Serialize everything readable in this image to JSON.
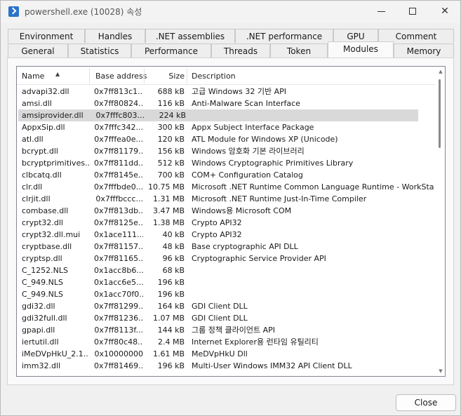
{
  "window": {
    "title": "powershell.exe (10028) 속성",
    "minimize_glyph": "—",
    "maximize_glyph": "☐",
    "close_glyph": "✕"
  },
  "tabs_top_row": [
    {
      "label": "Environment"
    },
    {
      "label": "Handles"
    },
    {
      "label": ".NET assemblies"
    },
    {
      "label": ".NET performance"
    },
    {
      "label": "GPU"
    },
    {
      "label": "Comment"
    }
  ],
  "tabs_bottom_row": [
    {
      "label": "General"
    },
    {
      "label": "Statistics"
    },
    {
      "label": "Performance"
    },
    {
      "label": "Threads"
    },
    {
      "label": "Token"
    },
    {
      "label": "Modules",
      "active": true
    },
    {
      "label": "Memory"
    }
  ],
  "table": {
    "columns": [
      "Name",
      "Base address",
      "Size",
      "Description"
    ],
    "sorted_column": "Name",
    "selected_index": 2,
    "rows": [
      {
        "name": "advapi32.dll",
        "addr": "0x7ff813c1...",
        "size": "688 kB",
        "desc": "고급 Windows 32 기반 API"
      },
      {
        "name": "amsi.dll",
        "addr": "0x7ff80824...",
        "size": "116 kB",
        "desc": "Anti-Malware Scan Interface"
      },
      {
        "name": "amsiprovider.dll",
        "addr": "0x7fffc803...",
        "size": "224 kB",
        "desc": ""
      },
      {
        "name": "AppxSip.dll",
        "addr": "0x7fffc342...",
        "size": "300 kB",
        "desc": "Appx Subject Interface Package"
      },
      {
        "name": "atl.dll",
        "addr": "0x7fffea0e...",
        "size": "120 kB",
        "desc": "ATL Module for Windows XP (Unicode)"
      },
      {
        "name": "bcrypt.dll",
        "addr": "0x7ff81179...",
        "size": "156 kB",
        "desc": "Windows 암호화 기본 라이브러리"
      },
      {
        "name": "bcryptprimitives...",
        "addr": "0x7ff811dd...",
        "size": "512 kB",
        "desc": "Windows Cryptographic Primitives Library"
      },
      {
        "name": "clbcatq.dll",
        "addr": "0x7ff8145e...",
        "size": "700 kB",
        "desc": "COM+ Configuration Catalog"
      },
      {
        "name": "clr.dll",
        "addr": "0x7fffbde0...",
        "size": "10.75 MB",
        "desc": "Microsoft .NET Runtime Common Language Runtime - WorkStation"
      },
      {
        "name": "clrjit.dll",
        "addr": "0x7fffbccc...",
        "size": "1.31 MB",
        "desc": "Microsoft .NET Runtime Just-In-Time Compiler"
      },
      {
        "name": "combase.dll",
        "addr": "0x7ff813db...",
        "size": "3.47 MB",
        "desc": "Windows용 Microsoft COM"
      },
      {
        "name": "crypt32.dll",
        "addr": "0x7ff8125e...",
        "size": "1.38 MB",
        "desc": "Crypto API32"
      },
      {
        "name": "crypt32.dll.mui",
        "addr": "0x1ace111...",
        "size": "40 kB",
        "desc": "Crypto API32"
      },
      {
        "name": "cryptbase.dll",
        "addr": "0x7ff81157...",
        "size": "48 kB",
        "desc": "Base cryptographic API DLL"
      },
      {
        "name": "cryptsp.dll",
        "addr": "0x7ff81165...",
        "size": "96 kB",
        "desc": "Cryptographic Service Provider API"
      },
      {
        "name": "C_1252.NLS",
        "addr": "0x1acc8b6...",
        "size": "68 kB",
        "desc": ""
      },
      {
        "name": "C_949.NLS",
        "addr": "0x1acc6e5...",
        "size": "196 kB",
        "desc": ""
      },
      {
        "name": "C_949.NLS",
        "addr": "0x1acc70f0...",
        "size": "196 kB",
        "desc": ""
      },
      {
        "name": "gdi32.dll",
        "addr": "0x7ff81299...",
        "size": "164 kB",
        "desc": "GDI Client DLL"
      },
      {
        "name": "gdi32full.dll",
        "addr": "0x7ff81236...",
        "size": "1.07 MB",
        "desc": "GDI Client DLL"
      },
      {
        "name": "gpapi.dll",
        "addr": "0x7ff8113f...",
        "size": "144 kB",
        "desc": "그룹 정책 클라이언트 API"
      },
      {
        "name": "iertutil.dll",
        "addr": "0x7ff80c48...",
        "size": "2.4 MB",
        "desc": "Internet Explorer용 런타임 유틸리티"
      },
      {
        "name": "iMeDVpHkU_2.1...",
        "addr": "0x10000000",
        "size": "1.61 MB",
        "desc": "MeDVpHkU Dll"
      },
      {
        "name": "imm32.dll",
        "addr": "0x7ff81469...",
        "size": "196 kB",
        "desc": "Multi-User Windows IMM32 API Client DLL"
      }
    ]
  },
  "footer": {
    "close_label": "Close"
  }
}
